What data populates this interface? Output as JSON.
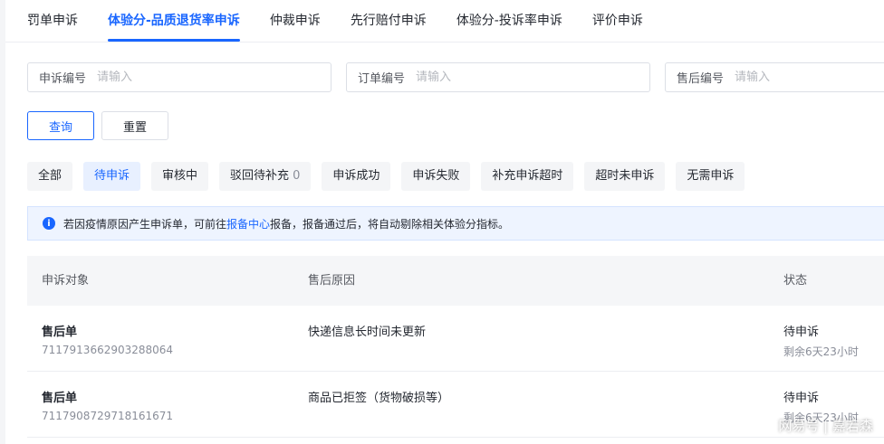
{
  "top_tabs": [
    {
      "label": "罚单申诉"
    },
    {
      "label": "体验分-品质退货率申诉"
    },
    {
      "label": "仲裁申诉"
    },
    {
      "label": "先行赔付申诉"
    },
    {
      "label": "体验分-投诉率申诉"
    },
    {
      "label": "评价申诉"
    }
  ],
  "active_top_tab": "体验分-品质退货率申诉",
  "filters": [
    {
      "label": "申诉编号",
      "placeholder": "请输入",
      "value": ""
    },
    {
      "label": "订单编号",
      "placeholder": "请输入",
      "value": ""
    },
    {
      "label": "售后编号",
      "placeholder": "请输入",
      "value": ""
    }
  ],
  "buttons": {
    "query": "查询",
    "reset": "重置"
  },
  "status_chips": [
    {
      "label": "全部",
      "count": ""
    },
    {
      "label": "待申诉",
      "count": ""
    },
    {
      "label": "审核中",
      "count": ""
    },
    {
      "label": "驳回待补充",
      "count": "0"
    },
    {
      "label": "申诉成功",
      "count": ""
    },
    {
      "label": "申诉失败",
      "count": ""
    },
    {
      "label": "补充申诉超时",
      "count": ""
    },
    {
      "label": "超时未申诉",
      "count": ""
    },
    {
      "label": "无需申诉",
      "count": ""
    }
  ],
  "active_status_chip": "待申诉",
  "notice": {
    "icon": "info-icon",
    "icon_glyph": "i",
    "prefix": "若因疫情原因产生申诉单，可前往",
    "link": "报备中心",
    "suffix": "报备，报备通过后，将自动剔除相关体验分指标。"
  },
  "table": {
    "headers": [
      "申诉对象",
      "售后原因",
      "状态"
    ],
    "rows": [
      {
        "object_type": "售后单",
        "object_id": "7117913662903288064",
        "reason": "快递信息长时间未更新",
        "status": "待申诉",
        "remaining": "剩余6天23小时"
      },
      {
        "object_type": "售后单",
        "object_id": "7117908729718161671",
        "reason": "商品已拒签（货物破损等）",
        "status": "待申诉",
        "remaining": "剩余6天23小时"
      }
    ]
  },
  "watermark": "网易号 | 嘉若森",
  "colors": {
    "accent": "#1966ff",
    "notice_bg": "#eef4ff",
    "chip_bg": "#f4f5f7"
  }
}
